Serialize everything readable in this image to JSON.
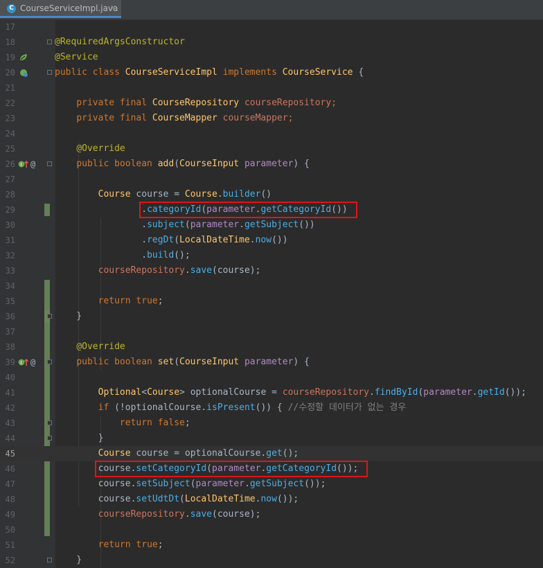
{
  "tab": {
    "filename": "CourseServiceImpl.java",
    "icon_letter": "C",
    "close_glyph": "×"
  },
  "gutter_icons": {
    "spring_bean": "spring-bean-icon",
    "implements": "implements-icon",
    "override": "override-up-icon",
    "annotation_glyph": "@"
  },
  "colors": {
    "background": "#2b2b2b",
    "gutter": "#313335",
    "keyword": "#cc7832",
    "annotation": "#bbb529",
    "field": "#c97660",
    "method": "#4eade5",
    "highlight_box": "#e0141a",
    "change_marker": "#6a8759"
  },
  "current_line": 45,
  "lines": [
    {
      "n": "17",
      "t": []
    },
    {
      "n": "18",
      "t": [
        {
          "c": "an",
          "v": "@RequiredArgsConstructor"
        }
      ]
    },
    {
      "n": "19",
      "t": [
        {
          "c": "an",
          "v": "@Service"
        }
      ]
    },
    {
      "n": "20",
      "t": [
        {
          "c": "kw",
          "v": "public class "
        },
        {
          "c": "ty",
          "v": "CourseServiceImpl "
        },
        {
          "c": "kw",
          "v": "implements "
        },
        {
          "c": "ty",
          "v": "CourseService "
        },
        {
          "c": "sy",
          "v": "{"
        }
      ]
    },
    {
      "n": "21",
      "t": []
    },
    {
      "n": "22",
      "t": [
        {
          "c": "sy",
          "v": "    "
        },
        {
          "c": "kw",
          "v": "private final "
        },
        {
          "c": "ty",
          "v": "CourseRepository "
        },
        {
          "c": "fd",
          "v": "courseRepository"
        },
        {
          "c": "kw",
          "v": ";"
        }
      ]
    },
    {
      "n": "23",
      "t": [
        {
          "c": "sy",
          "v": "    "
        },
        {
          "c": "kw",
          "v": "private final "
        },
        {
          "c": "ty",
          "v": "CourseMapper "
        },
        {
          "c": "fd",
          "v": "courseMapper"
        },
        {
          "c": "kw",
          "v": ";"
        }
      ]
    },
    {
      "n": "24",
      "t": []
    },
    {
      "n": "25",
      "t": [
        {
          "c": "sy",
          "v": "    "
        },
        {
          "c": "an",
          "v": "@Override"
        }
      ]
    },
    {
      "n": "26",
      "t": [
        {
          "c": "sy",
          "v": "    "
        },
        {
          "c": "kw",
          "v": "public boolean "
        },
        {
          "c": "ty",
          "v": "add"
        },
        {
          "c": "sy",
          "v": "("
        },
        {
          "c": "ty",
          "v": "CourseInput "
        },
        {
          "c": "pm",
          "v": "parameter"
        },
        {
          "c": "sy",
          "v": ") {"
        }
      ]
    },
    {
      "n": "27",
      "t": []
    },
    {
      "n": "28",
      "t": [
        {
          "c": "sy",
          "v": "        "
        },
        {
          "c": "ty",
          "v": "Course "
        },
        {
          "c": "sy",
          "v": "course = "
        },
        {
          "c": "ty",
          "v": "Course"
        },
        {
          "c": "sy",
          "v": "."
        },
        {
          "c": "mt",
          "v": "builder"
        },
        {
          "c": "sy",
          "v": "()"
        }
      ]
    },
    {
      "n": "29",
      "t": [
        {
          "c": "sy",
          "v": "                "
        },
        {
          "c": "sy",
          "v": "."
        },
        {
          "c": "mt",
          "v": "categoryId"
        },
        {
          "c": "sy",
          "v": "("
        },
        {
          "c": "pm",
          "v": "parameter"
        },
        {
          "c": "sy",
          "v": "."
        },
        {
          "c": "mt",
          "v": "getCategoryId"
        },
        {
          "c": "sy",
          "v": "())"
        }
      ]
    },
    {
      "n": "30",
      "t": [
        {
          "c": "sy",
          "v": "                "
        },
        {
          "c": "sy",
          "v": "."
        },
        {
          "c": "mt",
          "v": "subject"
        },
        {
          "c": "sy",
          "v": "("
        },
        {
          "c": "pm",
          "v": "parameter"
        },
        {
          "c": "sy",
          "v": "."
        },
        {
          "c": "mt",
          "v": "getSubject"
        },
        {
          "c": "sy",
          "v": "())"
        }
      ]
    },
    {
      "n": "31",
      "t": [
        {
          "c": "sy",
          "v": "                "
        },
        {
          "c": "sy",
          "v": "."
        },
        {
          "c": "mt",
          "v": "regDt"
        },
        {
          "c": "sy",
          "v": "("
        },
        {
          "c": "ty",
          "v": "LocalDateTime"
        },
        {
          "c": "sy",
          "v": "."
        },
        {
          "c": "mt",
          "v": "now"
        },
        {
          "c": "sy",
          "v": "())"
        }
      ]
    },
    {
      "n": "32",
      "t": [
        {
          "c": "sy",
          "v": "                "
        },
        {
          "c": "sy",
          "v": "."
        },
        {
          "c": "mt",
          "v": "build"
        },
        {
          "c": "sy",
          "v": "();"
        }
      ]
    },
    {
      "n": "33",
      "t": [
        {
          "c": "sy",
          "v": "        "
        },
        {
          "c": "fd",
          "v": "courseRepository"
        },
        {
          "c": "sy",
          "v": "."
        },
        {
          "c": "mt",
          "v": "save"
        },
        {
          "c": "sy",
          "v": "(course);"
        }
      ]
    },
    {
      "n": "34",
      "t": []
    },
    {
      "n": "35",
      "t": [
        {
          "c": "sy",
          "v": "        "
        },
        {
          "c": "kw",
          "v": "return true"
        },
        {
          "c": "sy",
          "v": ";"
        }
      ]
    },
    {
      "n": "36",
      "t": [
        {
          "c": "sy",
          "v": "    }"
        }
      ]
    },
    {
      "n": "37",
      "t": []
    },
    {
      "n": "38",
      "t": [
        {
          "c": "sy",
          "v": "    "
        },
        {
          "c": "an",
          "v": "@Override"
        }
      ]
    },
    {
      "n": "39",
      "t": [
        {
          "c": "sy",
          "v": "    "
        },
        {
          "c": "kw",
          "v": "public boolean "
        },
        {
          "c": "ty",
          "v": "set"
        },
        {
          "c": "sy",
          "v": "("
        },
        {
          "c": "ty",
          "v": "CourseInput "
        },
        {
          "c": "pm",
          "v": "parameter"
        },
        {
          "c": "sy",
          "v": ") {"
        }
      ]
    },
    {
      "n": "40",
      "t": []
    },
    {
      "n": "41",
      "t": [
        {
          "c": "sy",
          "v": "        "
        },
        {
          "c": "ty",
          "v": "Optional"
        },
        {
          "c": "sy",
          "v": "<"
        },
        {
          "c": "ty",
          "v": "Course"
        },
        {
          "c": "sy",
          "v": "> optionalCourse = "
        },
        {
          "c": "fd",
          "v": "courseRepository"
        },
        {
          "c": "sy",
          "v": "."
        },
        {
          "c": "mt",
          "v": "findById"
        },
        {
          "c": "sy",
          "v": "("
        },
        {
          "c": "pm",
          "v": "parameter"
        },
        {
          "c": "sy",
          "v": "."
        },
        {
          "c": "mt",
          "v": "getId"
        },
        {
          "c": "sy",
          "v": "());"
        }
      ]
    },
    {
      "n": "42",
      "t": [
        {
          "c": "sy",
          "v": "        "
        },
        {
          "c": "kw",
          "v": "if "
        },
        {
          "c": "sy",
          "v": "(!optionalCourse."
        },
        {
          "c": "mt",
          "v": "isPresent"
        },
        {
          "c": "sy",
          "v": "()) { "
        },
        {
          "c": "cm",
          "v": "//수정할 데이터가 없는 경우"
        }
      ]
    },
    {
      "n": "43",
      "t": [
        {
          "c": "sy",
          "v": "            "
        },
        {
          "c": "kw",
          "v": "return false"
        },
        {
          "c": "sy",
          "v": ";"
        }
      ]
    },
    {
      "n": "44",
      "t": [
        {
          "c": "sy",
          "v": "        }"
        }
      ]
    },
    {
      "n": "45",
      "t": [
        {
          "c": "sy",
          "v": "        "
        },
        {
          "c": "ty",
          "v": "Course "
        },
        {
          "c": "sy",
          "v": "course = optionalCourse."
        },
        {
          "c": "mt",
          "v": "get"
        },
        {
          "c": "sy",
          "v": "();"
        }
      ]
    },
    {
      "n": "46",
      "t": [
        {
          "c": "sy",
          "v": "        "
        },
        {
          "c": "sy",
          "v": "course."
        },
        {
          "c": "mt",
          "v": "setCategoryId"
        },
        {
          "c": "sy",
          "v": "("
        },
        {
          "c": "pm",
          "v": "parameter"
        },
        {
          "c": "sy",
          "v": "."
        },
        {
          "c": "mt",
          "v": "getCategoryId"
        },
        {
          "c": "sy",
          "v": "());"
        }
      ]
    },
    {
      "n": "47",
      "t": [
        {
          "c": "sy",
          "v": "        "
        },
        {
          "c": "sy",
          "v": "course."
        },
        {
          "c": "mt",
          "v": "setSubject"
        },
        {
          "c": "sy",
          "v": "("
        },
        {
          "c": "pm",
          "v": "parameter"
        },
        {
          "c": "sy",
          "v": "."
        },
        {
          "c": "mt",
          "v": "getSubject"
        },
        {
          "c": "sy",
          "v": "());"
        }
      ]
    },
    {
      "n": "48",
      "t": [
        {
          "c": "sy",
          "v": "        "
        },
        {
          "c": "sy",
          "v": "course."
        },
        {
          "c": "mt",
          "v": "setUdtDt"
        },
        {
          "c": "sy",
          "v": "("
        },
        {
          "c": "ty",
          "v": "LocalDateTime"
        },
        {
          "c": "sy",
          "v": "."
        },
        {
          "c": "mt",
          "v": "now"
        },
        {
          "c": "sy",
          "v": "());"
        }
      ]
    },
    {
      "n": "49",
      "t": [
        {
          "c": "sy",
          "v": "        "
        },
        {
          "c": "fd",
          "v": "courseRepository"
        },
        {
          "c": "sy",
          "v": "."
        },
        {
          "c": "mt",
          "v": "save"
        },
        {
          "c": "sy",
          "v": "(course);"
        }
      ]
    },
    {
      "n": "50",
      "t": []
    },
    {
      "n": "51",
      "t": [
        {
          "c": "sy",
          "v": "        "
        },
        {
          "c": "kw",
          "v": "return true"
        },
        {
          "c": "sy",
          "v": ";"
        }
      ]
    },
    {
      "n": "52",
      "t": [
        {
          "c": "sy",
          "v": "    }"
        }
      ]
    }
  ]
}
